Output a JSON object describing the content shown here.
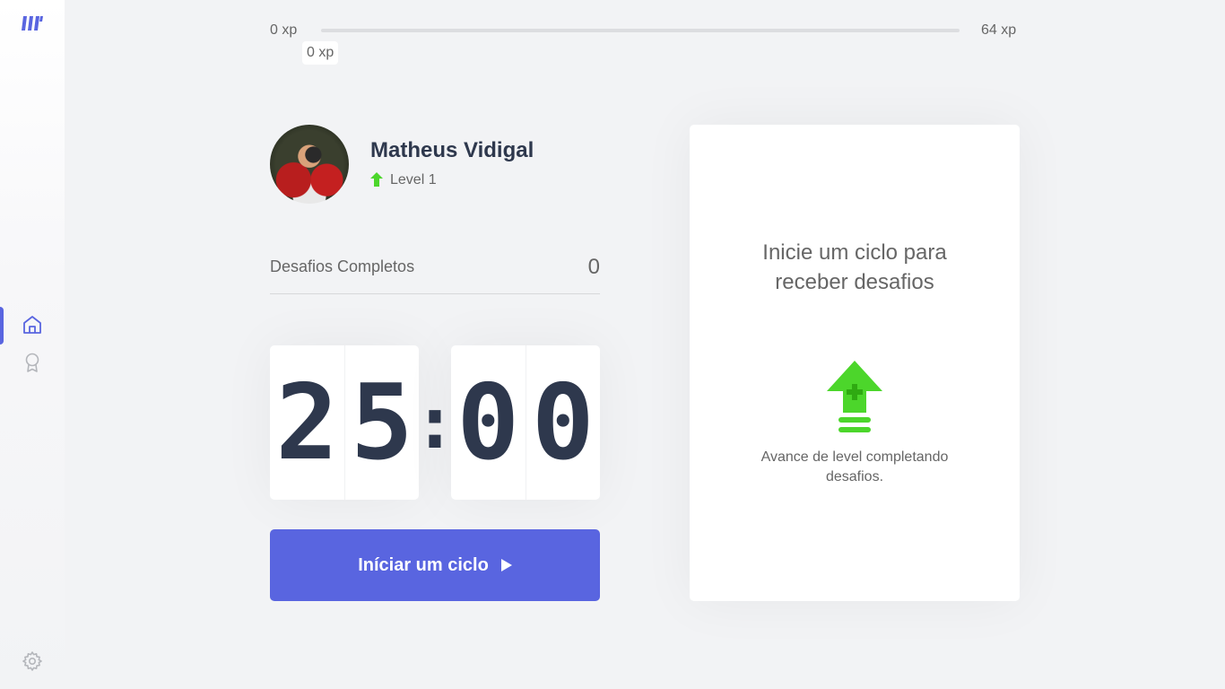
{
  "xp": {
    "min_label": "0 xp",
    "max_label": "64 xp",
    "current_label": "0 xp",
    "progress_percent": 0
  },
  "profile": {
    "name": "Matheus Vidigal",
    "level_label": "Level 1"
  },
  "completed": {
    "label": "Desafios Completos",
    "value": "0"
  },
  "countdown": {
    "minute_left": "2",
    "minute_right": "5",
    "separator": ":",
    "second_left": "0",
    "second_right": "0"
  },
  "start_button": {
    "label": "Iníciar um ciclo"
  },
  "challenge": {
    "title": "Inicie um ciclo para receber desafios",
    "text": "Avance de level completando desafios."
  },
  "sidebar": {
    "items": [
      {
        "icon": "home-icon",
        "active": true
      },
      {
        "icon": "award-icon",
        "active": false
      }
    ],
    "footer_icon": "gear-icon"
  },
  "colors": {
    "accent": "#5965e0",
    "green": "#4cd62b",
    "title": "#2e384d",
    "text": "#666666",
    "background": "#f2f3f5"
  }
}
